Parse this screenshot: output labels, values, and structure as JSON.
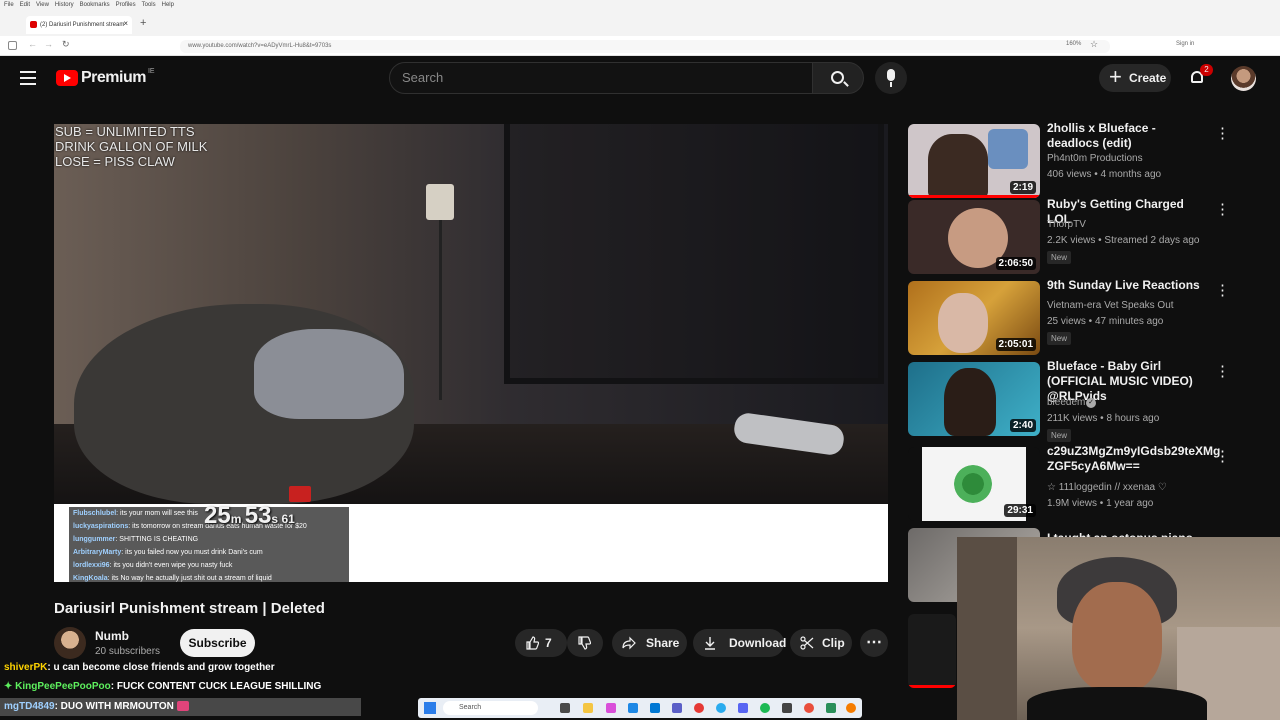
{
  "browser": {
    "menu": [
      "File",
      "Edit",
      "View",
      "History",
      "Bookmarks",
      "Profiles",
      "Tools",
      "Help"
    ],
    "tab_title": "(2) Dariusirl Punishment stream",
    "url": "www.youtube.com/watch?v=eADyVmrL-Hu8&t=9703s",
    "zoom": "160%",
    "sign_in": "Sign in"
  },
  "header": {
    "logo_text": "Premium",
    "country": "IE",
    "search_placeholder": "Search",
    "create_label": "Create",
    "notification_count": "2"
  },
  "player": {
    "overlay_lines": [
      "SUB = UNLIMITED TTS",
      "DRINK GALLON OF MILK",
      "LOSE = PISS CLAW"
    ],
    "timer_min": "25",
    "timer_sec": "53",
    "timer_frac": "61",
    "chat": [
      {
        "user": "Flubschlubel",
        "msg": ": its your mom will see this"
      },
      {
        "user": "luckyaspirations",
        "msg": ": its tomorrow on stream darius eats human waste for $20"
      },
      {
        "user": "lunggummer",
        "msg": ": SHITTING IS CHEATING"
      },
      {
        "user": "ArbitraryMarty",
        "msg": ": its you failed now you must drink Dani's cum"
      },
      {
        "user": "lordlexxi96",
        "msg": ": its you didn't even wipe you nasty fuck"
      },
      {
        "user": "KingKoala",
        "msg": ": its No way he actually just shit out a stream of liquid"
      }
    ]
  },
  "video": {
    "title": "Dariusirl Punishment stream | Deleted",
    "channel": "Numb",
    "subscribers": "20 subscribers",
    "subscribe_label": "Subscribe",
    "likes": "7",
    "share_label": "Share",
    "download_label": "Download",
    "clip_label": "Clip"
  },
  "recommendations": [
    {
      "title": "2hollis x Blueface - deadlocs (edit)",
      "channel": "Ph4nt0m Productions",
      "meta": "406 views • 4 months ago",
      "duration": "2:19",
      "badge": "",
      "color": "#cfc6c9"
    },
    {
      "title": "Ruby's Getting Charged LOL",
      "channel": "ThorpTV",
      "meta": "2.2K views • Streamed 2 days ago",
      "duration": "2:06:50",
      "badge": "New",
      "color": "#3a2a28"
    },
    {
      "title": "9th Sunday Live Reactions",
      "channel": "Vietnam-era Vet Speaks Out",
      "meta": "25 views • 47 minutes ago",
      "duration": "2:05:01",
      "badge": "New",
      "color": "#b0701c"
    },
    {
      "title": "Blueface - Baby Girl (OFFICIAL MUSIC VIDEO) @RLPvids",
      "channel": "bleedem",
      "meta": "211K views • 8 hours ago",
      "duration": "2:40",
      "badge": "New",
      "color": "#1e6f8a"
    },
    {
      "title": "c29uZ3MgZm9yIGdsb29teXMg ZGF5cyA6Mw==",
      "channel": "☆ 111loggedin // xxenaa ♡",
      "meta": "1.9M views • 1 year ago",
      "duration": "29:31",
      "badge": "",
      "color": "#f4f4f4"
    },
    {
      "title": "I taught an octopus piano (It",
      "channel": "",
      "meta": "",
      "duration": "",
      "badge": "",
      "color": "#6d6a68"
    }
  ],
  "stream_chat": [
    {
      "user": "shiverPK",
      "msg": ": u can become close friends and grow together"
    },
    {
      "user": "KingPeePeePooPoo",
      "msg": ": FUCK CONTENT CUCK LEAGUE SHILLING"
    },
    {
      "user": "mgTD4849",
      "msg": ": DUO WITH MRMOUTON"
    }
  ],
  "taskbar": {
    "search_label": "Search"
  },
  "colors": {
    "brand_red": "#ff0000",
    "background": "#0f0f0f"
  }
}
